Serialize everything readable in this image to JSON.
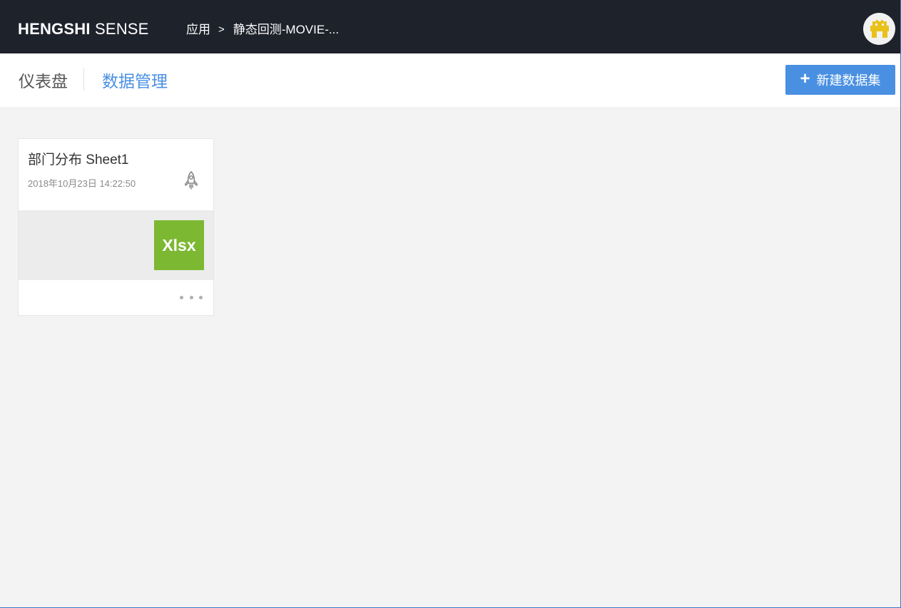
{
  "header": {
    "brand_bold": "HENGSHI",
    "brand_light": "SENSE",
    "breadcrumb": {
      "root": "应用",
      "separator": ">",
      "current": "静态回测-MOVIE-..."
    },
    "avatar_icon": "android-robot-icon",
    "avatar_color": "#e8c21a"
  },
  "subnav": {
    "tabs": [
      {
        "label": "仪表盘",
        "active": false
      },
      {
        "label": "数据管理",
        "active": true
      }
    ],
    "new_button": {
      "icon": "plus-icon",
      "label": "新建数据集"
    }
  },
  "datasets": [
    {
      "title": "部门分布 Sheet1",
      "timestamp": "2018年10月23日 14:22:50",
      "action_icon": "rocket-icon",
      "file_type": "Xlsx",
      "file_type_color": "#7cb832",
      "menu_icon": "more-dots-icon"
    }
  ],
  "colors": {
    "topbar": "#1e222b",
    "accent": "#4a90e2",
    "background": "#f3f3f3"
  }
}
